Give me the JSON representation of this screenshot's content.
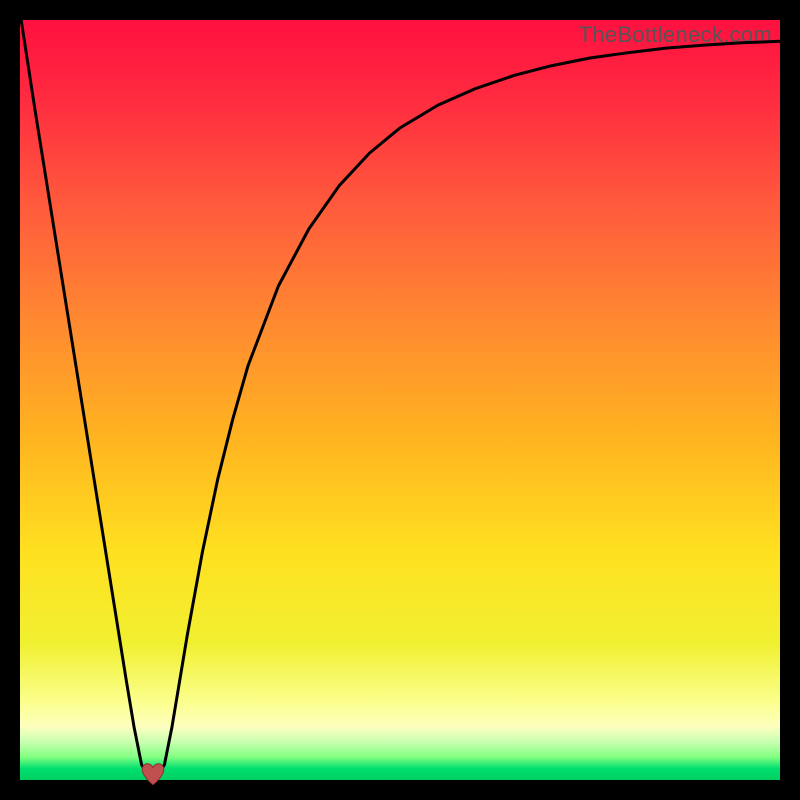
{
  "watermark": "TheBottleneck.com",
  "chart_data": {
    "type": "line",
    "title": "",
    "xlabel": "",
    "ylabel": "",
    "xlim": [
      0,
      1
    ],
    "ylim": [
      0,
      1
    ],
    "series": [
      {
        "name": "curve",
        "x": [
          0.0,
          0.01,
          0.02,
          0.04,
          0.06,
          0.08,
          0.1,
          0.12,
          0.14,
          0.15,
          0.16,
          0.17,
          0.18,
          0.19,
          0.2,
          0.21,
          0.22,
          0.24,
          0.26,
          0.28,
          0.3,
          0.34,
          0.38,
          0.42,
          0.46,
          0.5,
          0.55,
          0.6,
          0.65,
          0.7,
          0.75,
          0.8,
          0.85,
          0.9,
          0.95,
          1.0
        ],
        "values": [
          1.01,
          0.945,
          0.88,
          0.755,
          0.63,
          0.505,
          0.38,
          0.255,
          0.13,
          0.07,
          0.02,
          0.005,
          0.005,
          0.02,
          0.07,
          0.13,
          0.19,
          0.3,
          0.395,
          0.475,
          0.545,
          0.65,
          0.725,
          0.782,
          0.825,
          0.858,
          0.888,
          0.91,
          0.927,
          0.94,
          0.95,
          0.957,
          0.963,
          0.967,
          0.97,
          0.972
        ]
      }
    ],
    "marker": {
      "x": 0.175,
      "y": 0.008,
      "name": "heart"
    },
    "background": {
      "gradient": [
        "#ff1040",
        "#ff5c3c",
        "#ffb420",
        "#f0f030",
        "#fcff90",
        "#80ff80",
        "#00d060"
      ]
    }
  }
}
